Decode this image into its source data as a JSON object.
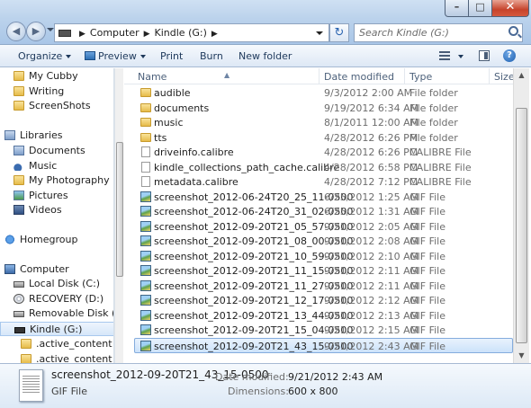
{
  "address": {
    "crumbs": [
      "Computer",
      "Kindle (G:)"
    ],
    "search_placeholder": "Search Kindle (G:)"
  },
  "window_buttons": {
    "minimize": "–",
    "maximize": "□",
    "close": "✕"
  },
  "toolbar": {
    "organize": "Organize",
    "preview": "Preview",
    "print": "Print",
    "burn": "Burn",
    "new_folder": "New folder",
    "help": "?"
  },
  "nav": {
    "favorites": [
      {
        "label": "My Cubby",
        "icon": "folder-icon"
      },
      {
        "label": "Writing",
        "icon": "folder-icon"
      },
      {
        "label": "ScreenShots",
        "icon": "folder-icon"
      }
    ],
    "libraries_label": "Libraries",
    "libraries": [
      {
        "label": "Documents",
        "icon": "documents-icon"
      },
      {
        "label": "Music",
        "icon": "music-icon"
      },
      {
        "label": "My Photography",
        "icon": "folder-icon"
      },
      {
        "label": "Pictures",
        "icon": "pictures-icon"
      },
      {
        "label": "Videos",
        "icon": "videos-icon"
      }
    ],
    "homegroup_label": "Homegroup",
    "computer_label": "Computer",
    "drives": [
      {
        "label": "Local Disk (C:)",
        "icon": "hard-disk-icon"
      },
      {
        "label": "RECOVERY (D:)",
        "icon": "cd-drive-icon"
      },
      {
        "label": "Removable Disk (F:",
        "icon": "removable-disk-icon"
      },
      {
        "label": "Kindle (G:)",
        "icon": "kindle-drive-icon",
        "selected": true
      }
    ],
    "kindle_children": [
      {
        "label": ".active_content",
        "icon": "folder-icon"
      },
      {
        "label": ".active_content_s",
        "icon": "folder-icon"
      }
    ]
  },
  "columns": {
    "name": "Name",
    "date": "Date modified",
    "type": "Type",
    "size": "Size"
  },
  "files": [
    {
      "name": "audible",
      "date": "9/3/2012 2:00 AM",
      "type": "File folder",
      "kind": "folder"
    },
    {
      "name": "documents",
      "date": "9/19/2012 6:34 AM",
      "type": "File folder",
      "kind": "folder"
    },
    {
      "name": "music",
      "date": "8/1/2011 12:00 AM",
      "type": "File folder",
      "kind": "folder"
    },
    {
      "name": "tts",
      "date": "4/28/2012 6:26 PM",
      "type": "File folder",
      "kind": "folder"
    },
    {
      "name": "driveinfo.calibre",
      "date": "4/28/2012 6:26 PM",
      "type": "CALIBRE File",
      "kind": "doc"
    },
    {
      "name": "kindle_collections_path_cache.calibre",
      "date": "4/28/2012 6:58 PM",
      "type": "CALIBRE File",
      "kind": "doc"
    },
    {
      "name": "metadata.calibre",
      "date": "4/28/2012 7:12 PM",
      "type": "CALIBRE File",
      "kind": "doc"
    },
    {
      "name": "screenshot_2012-06-24T20_25_11-0500",
      "date": "6/25/2012 1:25 AM",
      "type": "GIF File",
      "kind": "gif"
    },
    {
      "name": "screenshot_2012-06-24T20_31_02-0500",
      "date": "6/25/2012 1:31 AM",
      "type": "GIF File",
      "kind": "gif"
    },
    {
      "name": "screenshot_2012-09-20T21_05_57-0500",
      "date": "9/21/2012 2:05 AM",
      "type": "GIF File",
      "kind": "gif"
    },
    {
      "name": "screenshot_2012-09-20T21_08_00-0500",
      "date": "9/21/2012 2:08 AM",
      "type": "GIF File",
      "kind": "gif"
    },
    {
      "name": "screenshot_2012-09-20T21_10_59-0500",
      "date": "9/21/2012 2:10 AM",
      "type": "GIF File",
      "kind": "gif"
    },
    {
      "name": "screenshot_2012-09-20T21_11_15-0500",
      "date": "9/21/2012 2:11 AM",
      "type": "GIF File",
      "kind": "gif"
    },
    {
      "name": "screenshot_2012-09-20T21_11_27-0500",
      "date": "9/21/2012 2:11 AM",
      "type": "GIF File",
      "kind": "gif"
    },
    {
      "name": "screenshot_2012-09-20T21_12_17-0500",
      "date": "9/21/2012 2:12 AM",
      "type": "GIF File",
      "kind": "gif"
    },
    {
      "name": "screenshot_2012-09-20T21_13_44-0500",
      "date": "9/21/2012 2:13 AM",
      "type": "GIF File",
      "kind": "gif"
    },
    {
      "name": "screenshot_2012-09-20T21_15_04-0500",
      "date": "9/21/2012 2:15 AM",
      "type": "GIF File",
      "kind": "gif"
    },
    {
      "name": "screenshot_2012-09-20T21_43_15-0500",
      "date": "9/21/2012 2:43 AM",
      "type": "GIF File",
      "kind": "gif",
      "selected": true
    }
  ],
  "details": {
    "name": "screenshot_2012-09-20T21_43_15-0500",
    "type": "GIF File",
    "date_label": "Date modified:",
    "date_value": "9/21/2012 2:43 AM",
    "dims_label": "Dimensions:",
    "dims_value": "600 x 800"
  },
  "colors": {
    "selection": "#cce2fa",
    "selection_border": "#84acdd",
    "chrome": "#bcd3ec"
  }
}
